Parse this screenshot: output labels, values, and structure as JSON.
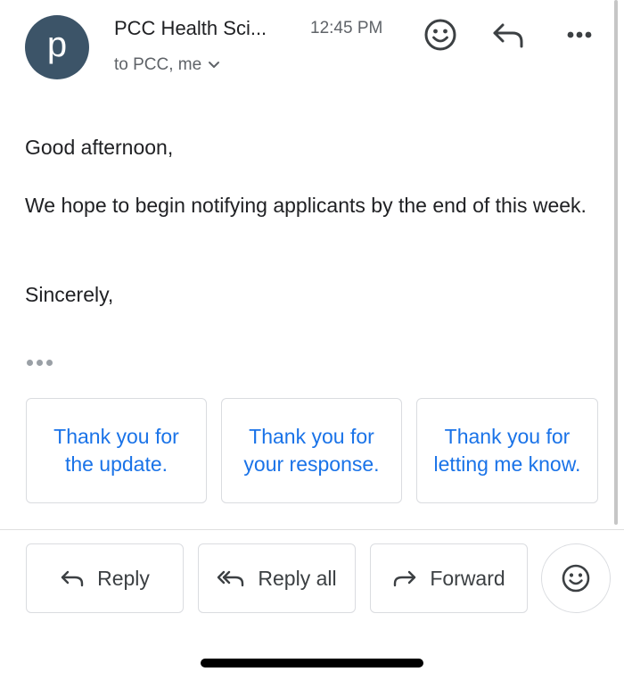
{
  "header": {
    "avatar_letter": "p",
    "sender": "PCC Health Sci...",
    "time": "12:45 PM",
    "recipients": "to PCC, me",
    "icons": [
      "add-emoji-reaction-icon",
      "reply-icon",
      "more-options-icon"
    ]
  },
  "message": {
    "greeting": "Good afternoon,",
    "paragraph": "We hope to begin notifying applicants by the end of this week.",
    "closing": "Sincerely,"
  },
  "smart_replies": [
    "Thank you for the update.",
    "Thank you for your response.",
    "Thank you for letting me know."
  ],
  "actions": {
    "reply": "Reply",
    "reply_all": "Reply all",
    "forward": "Forward"
  },
  "colors": {
    "avatar_bg": "#3c5468",
    "link_blue": "#1a73e8",
    "text": "#202124",
    "secondary_text": "#5f6368",
    "border": "#dadce0"
  }
}
